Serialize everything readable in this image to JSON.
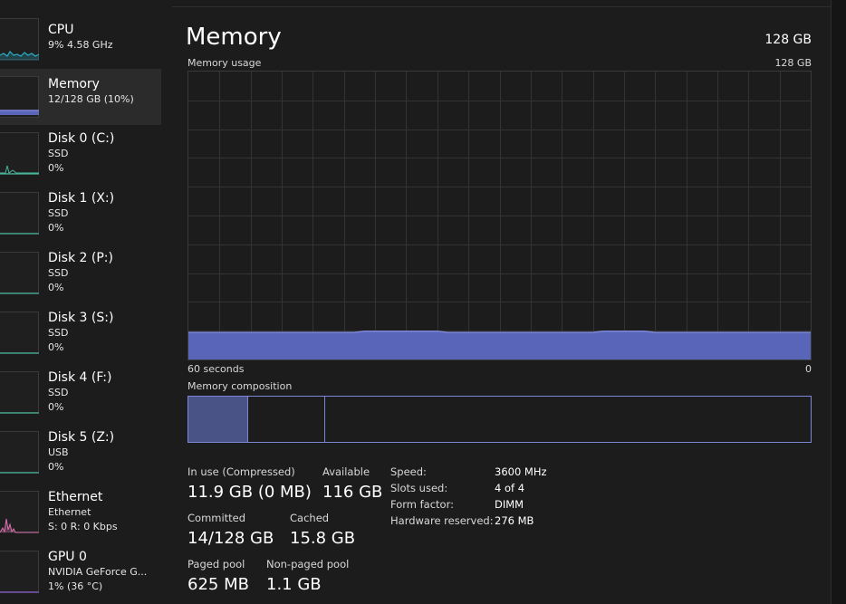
{
  "colors": {
    "memory_accent": "#7d86d6",
    "memory_fill": "#5865b8",
    "cpu_accent": "#2ab0c6",
    "disk_accent": "#48b59a",
    "ethernet_accent": "#d96fb0",
    "gpu_accent": "#8b5fd0"
  },
  "sidebar": {
    "items": [
      {
        "title": "CPU",
        "sub1": "9%  4.58 GHz",
        "sub2": "",
        "icon": "cpu-usage-graph"
      },
      {
        "title": "Memory",
        "sub1": "12/128 GB (10%)",
        "sub2": "",
        "icon": "memory-usage-graph"
      },
      {
        "title": "Disk 0 (C:)",
        "sub1": "SSD",
        "sub2": "0%",
        "icon": "disk-usage-graph"
      },
      {
        "title": "Disk 1 (X:)",
        "sub1": "SSD",
        "sub2": "0%",
        "icon": "disk-usage-graph"
      },
      {
        "title": "Disk 2 (P:)",
        "sub1": "SSD",
        "sub2": "0%",
        "icon": "disk-usage-graph"
      },
      {
        "title": "Disk 3 (S:)",
        "sub1": "SSD",
        "sub2": "0%",
        "icon": "disk-usage-graph"
      },
      {
        "title": "Disk 4 (F:)",
        "sub1": "SSD",
        "sub2": "0%",
        "icon": "disk-usage-graph"
      },
      {
        "title": "Disk 5 (Z:)",
        "sub1": "USB",
        "sub2": "0%",
        "icon": "disk-usage-graph"
      },
      {
        "title": "Ethernet",
        "sub1": "Ethernet",
        "sub2": "S: 0  R: 0 Kbps",
        "icon": "network-usage-graph"
      },
      {
        "title": "GPU 0",
        "sub1": "NVIDIA GeForce G...",
        "sub2": "1% (36 °C)",
        "icon": "gpu-usage-graph"
      }
    ]
  },
  "main": {
    "title": "Memory",
    "capacity": "128 GB",
    "usage_label": "Memory usage",
    "usage_max": "128 GB",
    "time_left": "60 seconds",
    "time_right": "0",
    "composition_label": "Memory composition",
    "usage_level": 0.094,
    "stats": {
      "in_use_label": "In use (Compressed)",
      "in_use_value": "11.9 GB (0 MB)",
      "available_label": "Available",
      "available_value": "116 GB",
      "committed_label": "Committed",
      "committed_value": "14/128 GB",
      "cached_label": "Cached",
      "cached_value": "15.8 GB",
      "paged_label": "Paged pool",
      "paged_value": "625 MB",
      "nonpaged_label": "Non-paged pool",
      "nonpaged_value": "1.1 GB"
    },
    "info": [
      {
        "key": "Speed:",
        "value": "3600 MHz"
      },
      {
        "key": "Slots used:",
        "value": "4 of 4"
      },
      {
        "key": "Form factor:",
        "value": "DIMM"
      },
      {
        "key": "Hardware reserved:",
        "value": "276 MB"
      }
    ]
  }
}
